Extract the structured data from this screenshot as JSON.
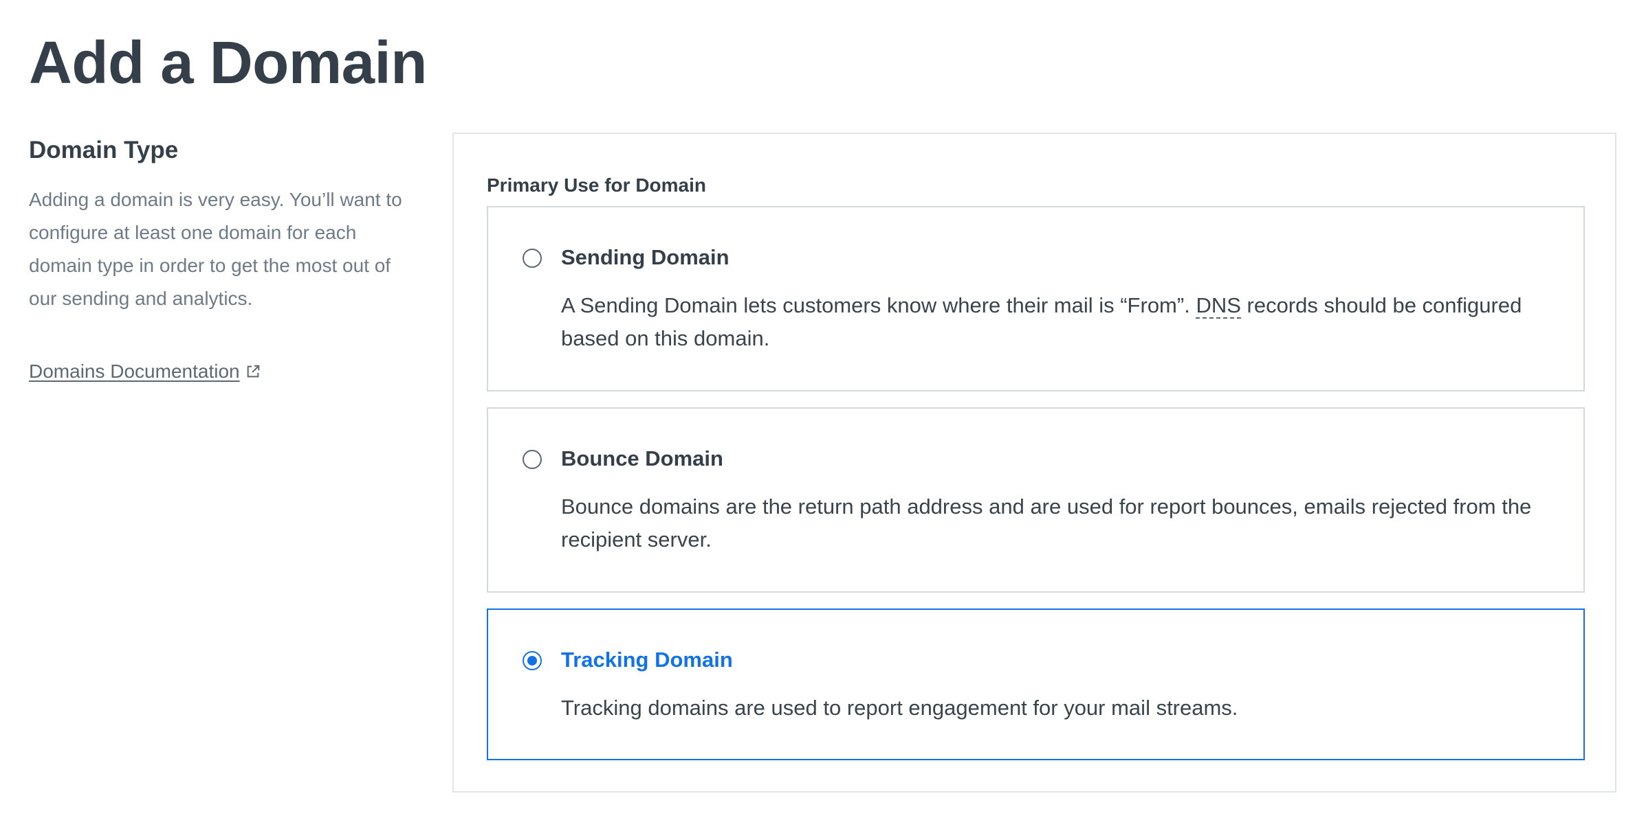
{
  "page": {
    "title": "Add a Domain"
  },
  "sidebar": {
    "heading": "Domain Type",
    "description": "Adding a domain is very easy. You’ll want to configure at least one domain for each domain type in order to get the most out of our sending and analytics.",
    "doc_link_label": "Domains Documentation",
    "doc_link_icon": "external-link-icon"
  },
  "form": {
    "field_label": "Primary Use for Domain",
    "selected": "tracking",
    "options": [
      {
        "id": "sending",
        "title": "Sending Domain",
        "desc_before": "A Sending Domain lets customers know where their mail is “From”. ",
        "desc_abbr": "DNS",
        "desc_after": " records should be configured based on this domain.",
        "selected": false
      },
      {
        "id": "bounce",
        "title": "Bounce Domain",
        "description": "Bounce domains are the return path address and are used for report bounces, emails rejected from the recipient server.",
        "selected": false
      },
      {
        "id": "tracking",
        "title": "Tracking Domain",
        "description": "Tracking domains are used to report engagement for your mail streams.",
        "selected": true
      }
    ]
  },
  "colors": {
    "accent": "#1273e6",
    "text": "#39444d",
    "muted": "#6e7b87",
    "border": "#d4d9dd"
  }
}
